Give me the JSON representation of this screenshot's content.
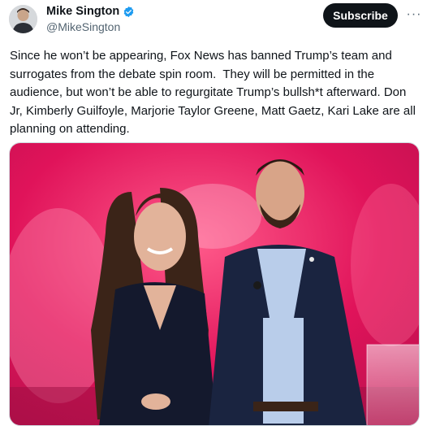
{
  "author": {
    "display_name": "Mike Sington",
    "handle": "@MikeSington",
    "verified_icon": "verified-badge-icon",
    "avatar_icon": "user-avatar"
  },
  "actions": {
    "subscribe_label": "Subscribe",
    "more_icon": "more-horizontal-icon",
    "more_glyph": "···"
  },
  "tweet": {
    "text": "Since he won’t be appearing, Fox News has banned Trump’s team and surrogates from the debate spin room.  They will be permitted in the audience, but won’t be able to regurgitate Trump’s bullsh*t afterward. Don Jr, Kimberly Guilfoyle, Marjorie Taylor Greene, Matt Gaetz, Kari Lake are all planning on attending."
  },
  "media": {
    "type": "photo",
    "description_icon": "tweet-photo"
  },
  "colors": {
    "accent_verified": "#1d9bf0",
    "text_primary": "#0f1419",
    "text_secondary": "#536471",
    "button_dark": "#0f1419",
    "stage_pink": "#e0135a"
  }
}
